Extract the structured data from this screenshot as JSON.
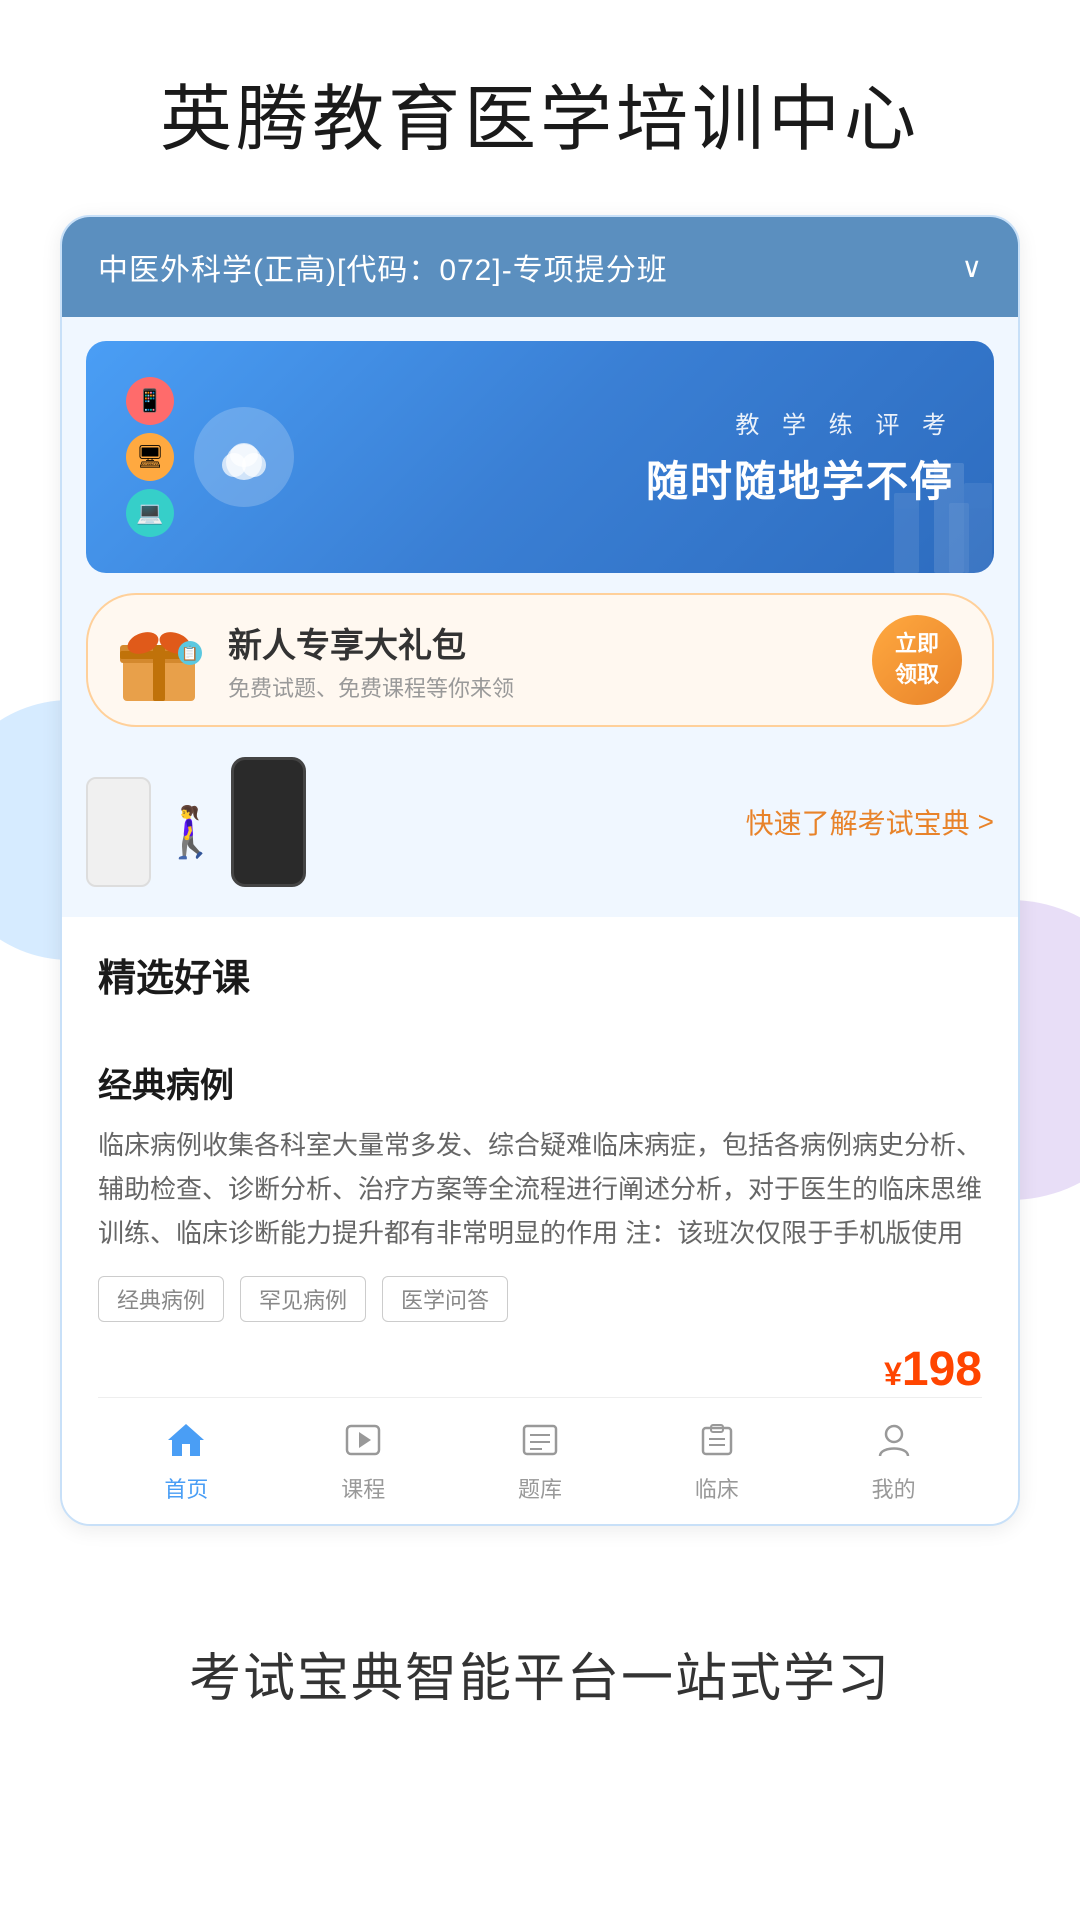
{
  "header": {
    "title": "英腾教育医学培训中心"
  },
  "course_selector": {
    "text": "中医外科学(正高)[代码：072]-专项提分班",
    "chevron": "∨"
  },
  "banner": {
    "subtitle": "教 学 练 评 考",
    "title": "随时随地学不停",
    "icon": "☁"
  },
  "gift_banner": {
    "title": "新人专享大礼包",
    "subtitle": "免费试题、免费课程等你来领",
    "button_line1": "立即",
    "button_line2": "领取"
  },
  "quick_link": {
    "label": "快速了解考试宝典",
    "arrow": ">"
  },
  "selected_courses": {
    "section_title": "精选好课",
    "course": {
      "name": "经典病例",
      "description": "临床病例收集各科室大量常多发、综合疑难临床病症，包括各病例病史分析、辅助检查、诊断分析、治疗方案等全流程进行阐述分析，对于医生的临床思维训练、临床诊断能力提升都有非常明显的作用\n注：该班次仅限于手机版使用",
      "tags": [
        "经典病例",
        "罕见病例",
        "医学问答"
      ],
      "price": "198",
      "price_symbol": "¥"
    }
  },
  "bottom_nav": {
    "items": [
      {
        "label": "首页",
        "icon": "home",
        "active": true
      },
      {
        "label": "课程",
        "icon": "play",
        "active": false
      },
      {
        "label": "题库",
        "icon": "list",
        "active": false
      },
      {
        "label": "临床",
        "icon": "clipboard",
        "active": false
      },
      {
        "label": "我的",
        "icon": "person",
        "active": false
      }
    ]
  },
  "footer": {
    "tagline": "考试宝典智能平台一站式学习"
  }
}
